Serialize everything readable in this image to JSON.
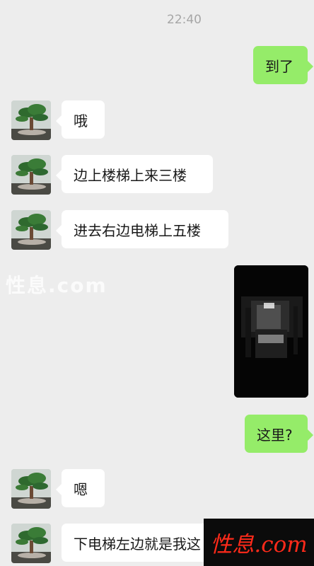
{
  "chat": {
    "timestamp": "22:40",
    "messages": [
      {
        "side": "right",
        "text": "到了"
      },
      {
        "side": "left",
        "text": "哦"
      },
      {
        "side": "left",
        "text": "边上楼梯上来三楼"
      },
      {
        "side": "left",
        "text": "进去右边电梯上五楼"
      },
      {
        "side": "right",
        "type": "image"
      },
      {
        "side": "right",
        "text": "这里?"
      },
      {
        "side": "left",
        "text": "嗯"
      },
      {
        "side": "left",
        "text": "下电梯左边就是我这"
      }
    ]
  },
  "watermark": {
    "text": "性息.com",
    "logo_text": "性息.com"
  },
  "colors": {
    "background": "#ededed",
    "incoming_bubble": "#ffffff",
    "outgoing_bubble": "#95ec69",
    "logo_red": "#ff2a1a"
  },
  "icons": {
    "avatar": "bonsai-avatar-icon"
  }
}
